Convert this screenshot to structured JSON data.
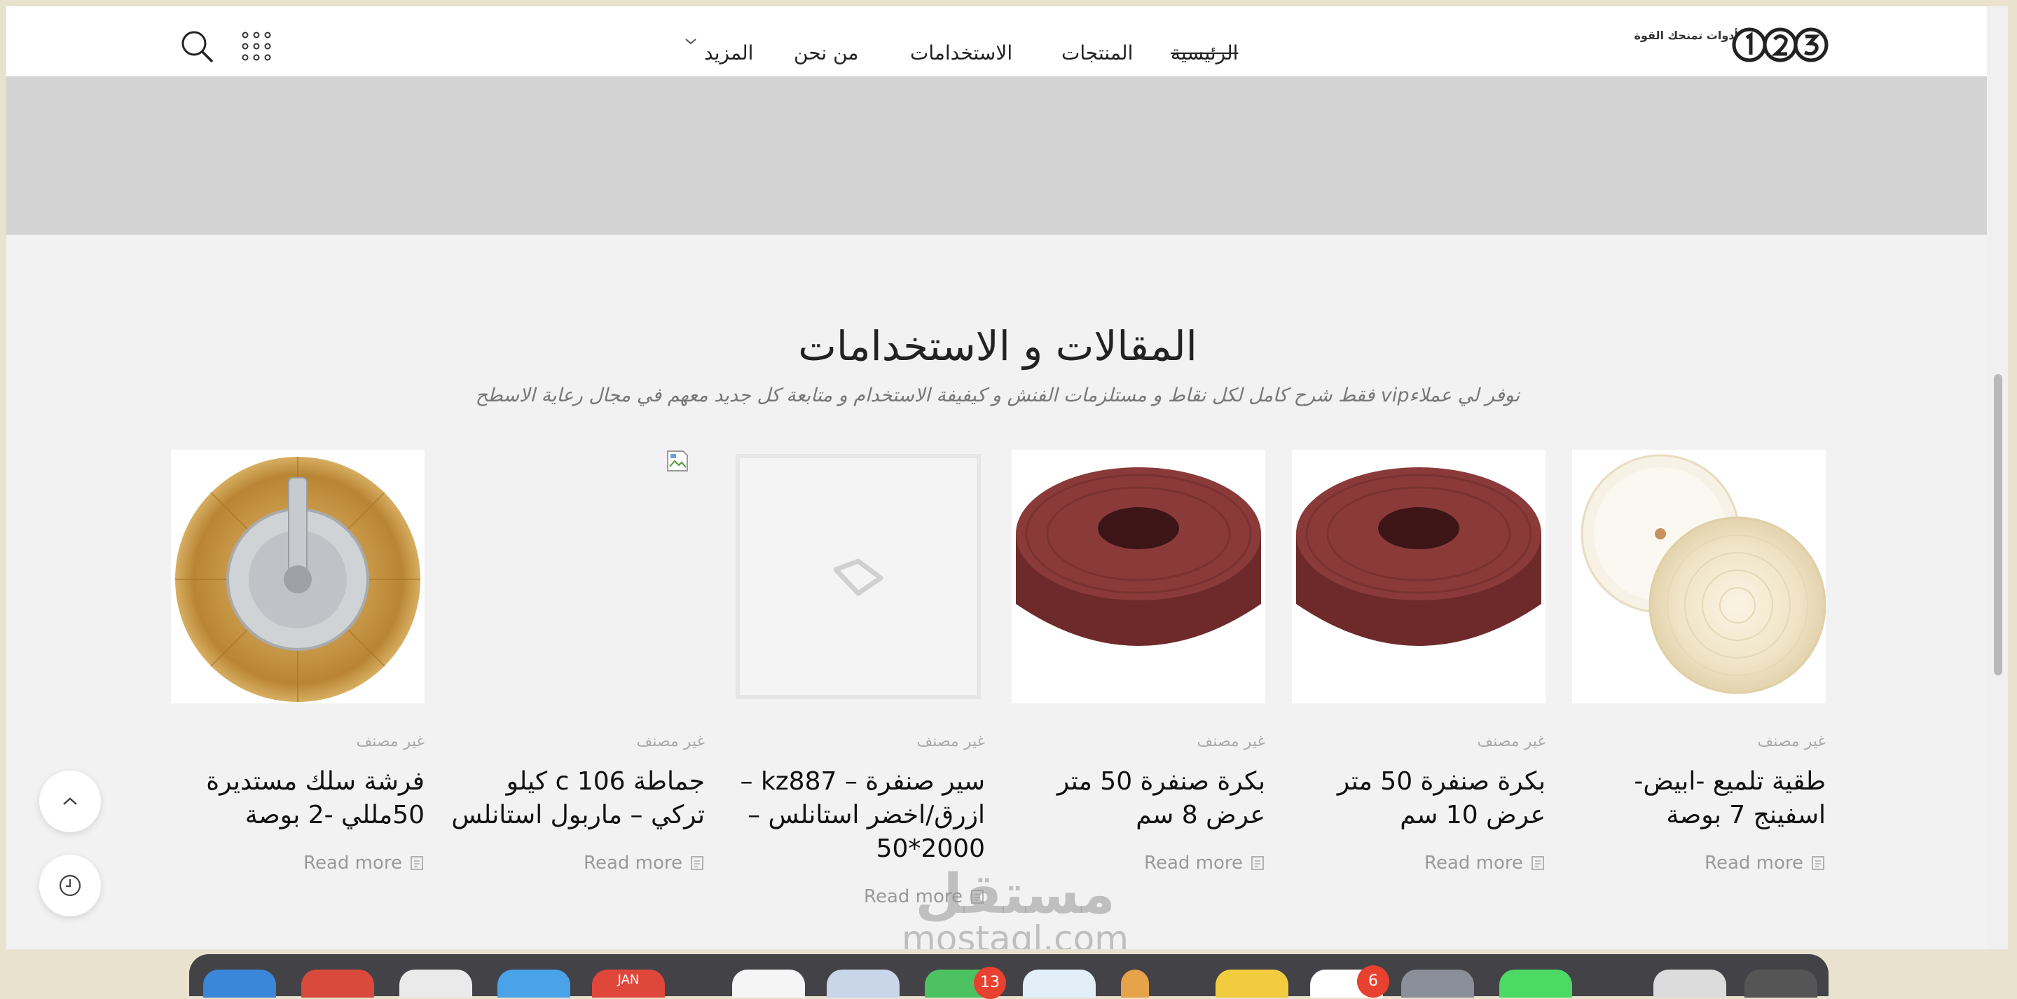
{
  "header": {
    "logo_tagline": "أدوات تمنحك القوة",
    "nav": {
      "home": "الرئيسية",
      "products": "المنتجات",
      "uses": "الاستخدامات",
      "about": "من نحن",
      "more": "المزيد"
    },
    "icons": [
      "grid-icon",
      "search-icon",
      "chevron-down-icon"
    ]
  },
  "section": {
    "title": "المقالات و الاستخدامات",
    "subtitle": "نوفر لي عملاءvip فقط شرح كامل لكل نقاط و مستلزمات الفنش و كيفيفة الاستخدام و متابعة كل جديد معهم في مجال رعاية الاسطح"
  },
  "cards": [
    {
      "category": "غير مصنف",
      "title": "طقية تلميع -ابيض- اسفينج 7 بوصة",
      "more": "Read more",
      "image": "polishing-pad"
    },
    {
      "category": "غير مصنف",
      "title": "بكرة صنفرة 50 متر عرض 10 سم",
      "more": "Read more",
      "image": "sanding-roll"
    },
    {
      "category": "غير مصنف",
      "title": "بكرة صنفرة 50 متر عرض 8 سم",
      "more": "Read more",
      "image": "sanding-roll"
    },
    {
      "category": "غير مصنف",
      "title": "سير صنفرة – kz887 – ازرق/اخضر استانلس – 2000*50",
      "more": "Read more",
      "image": "placeholder"
    },
    {
      "category": "غير مصنف",
      "title": "جماطة 106 c كيلو تركي – ماربول استانلس",
      "more": "Read more",
      "image": "broken"
    },
    {
      "category": "غير مصنف",
      "title": "فرشة سلك مستديرة 50مللي -2 بوصة",
      "more": "Read more",
      "image": "wire-brush"
    }
  ],
  "floating": {
    "scroll_top": "chevron-up-icon",
    "history": "clock-icon"
  },
  "watermark": {
    "arabic": "مستقل",
    "latin": "mostaql.com"
  },
  "dock": {
    "badges": [
      "13",
      "6"
    ],
    "calendar_month": "JAN"
  },
  "colors": {
    "page_bg": "#f2f2f2",
    "band_gray": "#d3d3d3",
    "text_dark": "#222222",
    "muted": "#9a9a9a"
  }
}
